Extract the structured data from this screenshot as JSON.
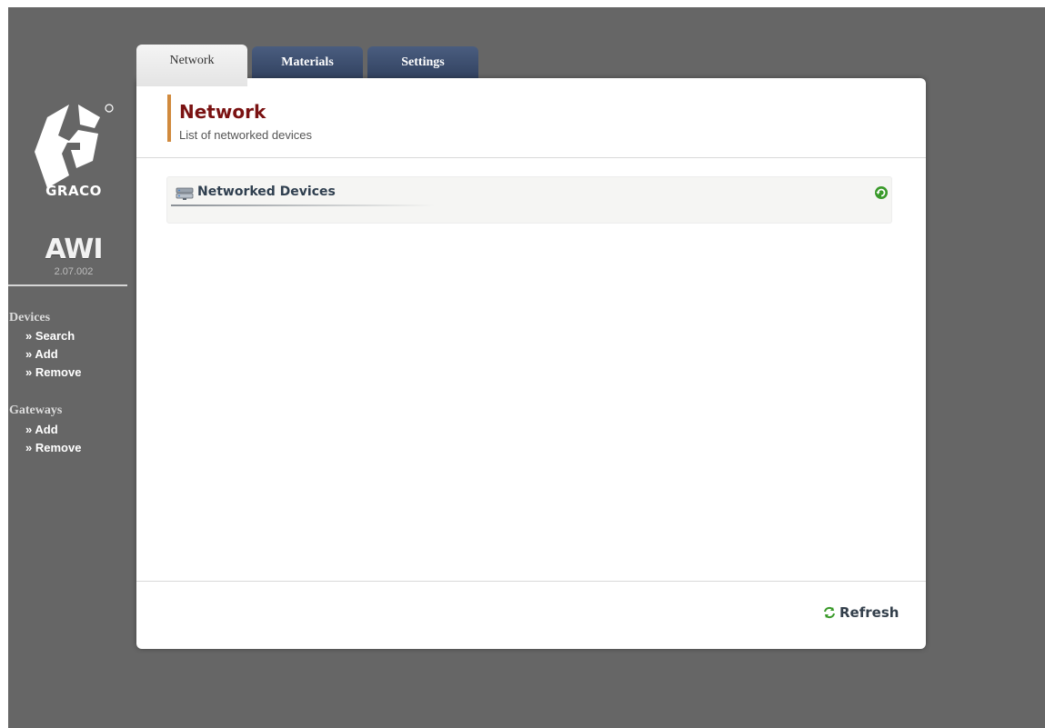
{
  "brand": {
    "company": "GRACO",
    "product": "AWI",
    "version": "2.07.002"
  },
  "tabs": [
    {
      "label": "Network",
      "active": true
    },
    {
      "label": "Materials",
      "active": false
    },
    {
      "label": "Settings",
      "active": false
    }
  ],
  "sidebar": {
    "groups": [
      {
        "title": "Devices",
        "links": [
          "» Search",
          "» Add",
          "» Remove"
        ]
      },
      {
        "title": "Gateways",
        "links": [
          "» Add",
          "» Remove"
        ]
      }
    ]
  },
  "main": {
    "title": "Network",
    "subtitle": "List of networked devices",
    "devices_section_title": "Networked Devices",
    "refresh_label": "Refresh"
  },
  "colors": {
    "background": "#666666",
    "title": "#7a1212",
    "accent": "#d18a3d",
    "tab_inactive": "#3b4c6c",
    "icon_green": "#3a9a2a"
  },
  "icons": {
    "devices": "server-icon",
    "reload": "reload-icon",
    "refresh": "refresh-icon"
  }
}
